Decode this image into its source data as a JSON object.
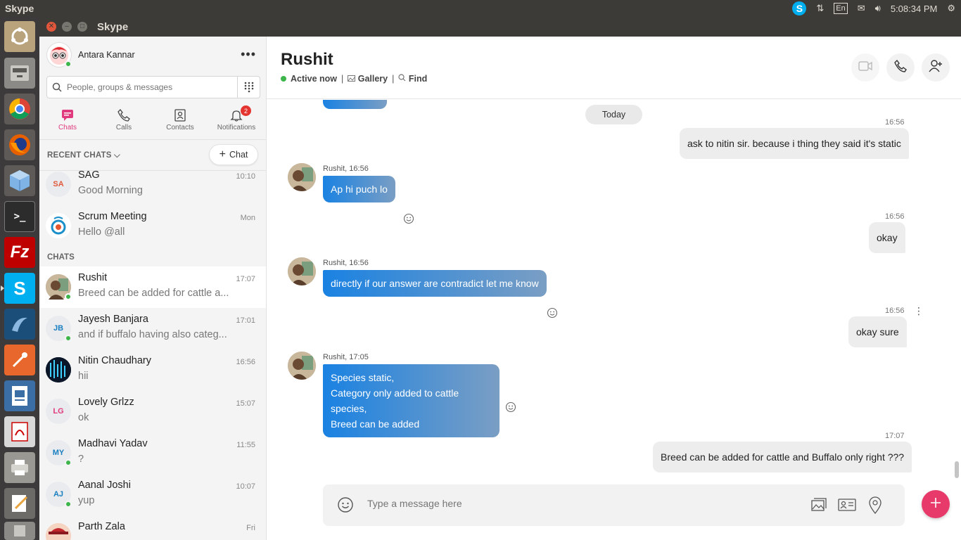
{
  "top_panel": {
    "app_name": "Skype",
    "lang": "En",
    "clock": "5:08:34 PM"
  },
  "window": {
    "title": "Skype"
  },
  "profile": {
    "name": "Antara Kannar"
  },
  "search": {
    "placeholder": "People, groups & messages"
  },
  "nav": {
    "tabs": [
      {
        "label": "Chats",
        "icon": "chat-icon",
        "active": true
      },
      {
        "label": "Calls",
        "icon": "phone-icon"
      },
      {
        "label": "Contacts",
        "icon": "contacts-icon"
      },
      {
        "label": "Notifications",
        "icon": "bell-icon",
        "badge": "2"
      }
    ]
  },
  "recent": {
    "header": "RECENT CHATS",
    "new_chat_label": "Chat"
  },
  "chats_header": "CHATS",
  "recent_chats": [
    {
      "name": "SAG",
      "initials": "SA",
      "preview": "Good Morning",
      "time": "10:10"
    },
    {
      "name": "Scrum Meeting",
      "preview": "Hello @all",
      "time": "Mon"
    }
  ],
  "chat_list": [
    {
      "name": "Rushit",
      "preview": "Breed can be added  for cattle a...",
      "time": "17:07",
      "selected": true,
      "online": true
    },
    {
      "name": "Jayesh Banjara",
      "initials": "JB",
      "preview": "and if buffalo having also categ...",
      "time": "17:01",
      "online": true
    },
    {
      "name": "Nitin Chaudhary",
      "preview": "hii",
      "time": "16:56"
    },
    {
      "name": "Lovely Grlzz",
      "initials": "LG",
      "preview": "ok",
      "time": "15:07"
    },
    {
      "name": "Madhavi Yadav",
      "initials": "MY",
      "preview": "?",
      "time": "11:55",
      "online": true
    },
    {
      "name": "Aanal Joshi",
      "initials": "AJ",
      "preview": "yup",
      "time": "10:07",
      "online": true
    },
    {
      "name": "Parth Zala",
      "preview": "",
      "time": "Fri"
    }
  ],
  "conversation": {
    "title": "Rushit",
    "status": "Active now",
    "gallery": "Gallery",
    "find": "Find",
    "day": "Today",
    "messages": [
      {
        "dir": "out",
        "time": "16:56",
        "text": "ask to nitin sir. because i thing they said it's static"
      },
      {
        "dir": "in",
        "sender": "Rushit, 16:56",
        "text": "Ap hi puch lo"
      },
      {
        "dir": "out",
        "time": "16:56",
        "text": "okay"
      },
      {
        "dir": "in",
        "sender": "Rushit, 16:56",
        "text": "directly if our answer are contradict let me know"
      },
      {
        "dir": "out",
        "time": "16:56",
        "text": "okay sure"
      },
      {
        "dir": "in",
        "sender": "Rushit, 17:05",
        "lines": [
          "Species static,",
          "Category only added to cattle species,",
          "Breed can be added"
        ]
      },
      {
        "dir": "out",
        "time": "17:07",
        "text": "Breed can be added  for cattle and Buffalo only right ???"
      }
    ]
  },
  "composer": {
    "placeholder": "Type a message here"
  },
  "colors": {
    "accent": "#e0397d",
    "bubble_in_start": "#1a82e2",
    "online": "#3cb54a",
    "badge": "#e3342f"
  }
}
